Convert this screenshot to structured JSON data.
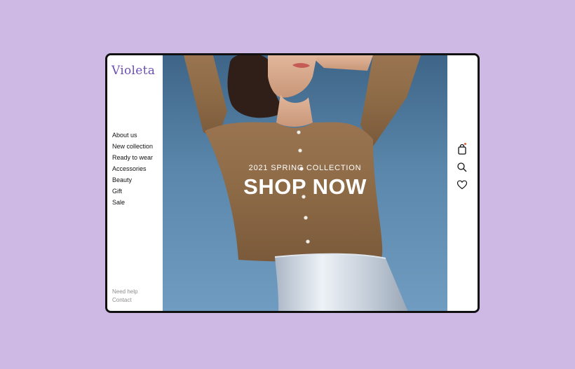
{
  "brand": {
    "logo": "Violeta",
    "accent_color": "#6a4fb8"
  },
  "sidebar": {
    "nav_items": [
      {
        "label": "About us"
      },
      {
        "label": "New collection"
      },
      {
        "label": "Ready to wear"
      },
      {
        "label": "Accessories"
      },
      {
        "label": "Beauty"
      },
      {
        "label": "Gift"
      },
      {
        "label": "Sale"
      }
    ],
    "footer_links": [
      {
        "label": "Need help"
      },
      {
        "label": "Contact"
      }
    ]
  },
  "hero": {
    "subtitle": "2021 SPRING COLLECTION",
    "cta": "SHOP NOW",
    "image": "model-in-gold-cardigan-and-silver-skirt"
  },
  "toolbar": {
    "icons": [
      "shopping-bag-icon",
      "search-icon",
      "heart-icon"
    ],
    "cart_badge_color": "#e0623a"
  }
}
